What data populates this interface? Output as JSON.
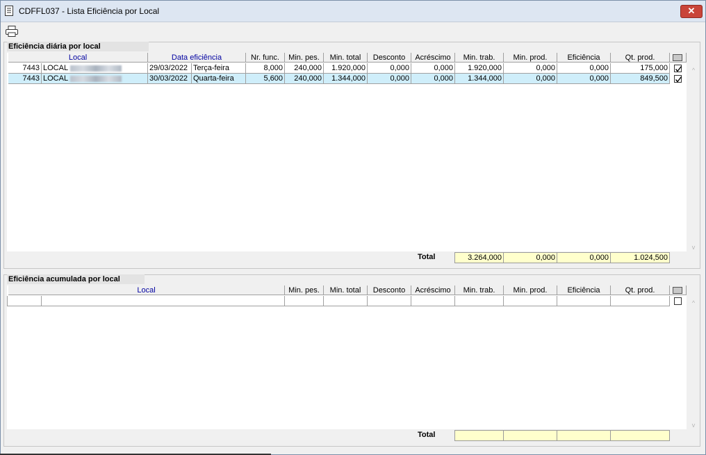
{
  "window": {
    "title": "CDFFL037 - Lista Eficiência por Local",
    "close_symbol": "✕"
  },
  "daily": {
    "title": "Eficiência diária por local",
    "headers": {
      "local": "Local",
      "data": "Data eficiência",
      "nr_func": "Nr. func.",
      "min_pes": "Min. pes.",
      "min_total": "Min. total",
      "desconto": "Desconto",
      "acrescimo": "Acréscimo",
      "min_trab": "Min. trab.",
      "min_prod": "Min. prod.",
      "eficiencia": "Eficiência",
      "qt_prod": "Qt. prod."
    },
    "rows": [
      {
        "code": "7443",
        "local": "LOCAL",
        "date": "29/03/2022",
        "weekday": "Terça-feira",
        "nr_func": "8,000",
        "min_pes": "240,000",
        "min_total": "1.920,000",
        "desconto": "0,000",
        "acrescimo": "0,000",
        "min_trab": "1.920,000",
        "min_prod": "0,000",
        "eficiencia": "0,000",
        "qt_prod": "175,000",
        "checked": true
      },
      {
        "code": "7443",
        "local": "LOCAL",
        "date": "30/03/2022",
        "weekday": "Quarta-feira",
        "nr_func": "5,600",
        "min_pes": "240,000",
        "min_total": "1.344,000",
        "desconto": "0,000",
        "acrescimo": "0,000",
        "min_trab": "1.344,000",
        "min_prod": "0,000",
        "eficiencia": "0,000",
        "qt_prod": "849,500",
        "checked": true
      }
    ],
    "total": {
      "label": "Total",
      "min_trab": "3.264,000",
      "min_prod": "0,000",
      "eficiencia": "0,000",
      "qt_prod": "1.024,500"
    }
  },
  "accumulated": {
    "title": "Eficiência acumulada por local",
    "headers": {
      "local": "Local",
      "min_pes": "Min. pes.",
      "min_total": "Min. total",
      "desconto": "Desconto",
      "acrescimo": "Acréscimo",
      "min_trab": "Min. trab.",
      "min_prod": "Min. prod.",
      "eficiencia": "Eficiência",
      "qt_prod": "Qt. prod."
    },
    "total": {
      "label": "Total"
    }
  },
  "colors": {
    "selected_row": "#cfeefa",
    "total_bg": "#ffffcc",
    "header_blue": "#0000a0"
  },
  "icons": {
    "title": "document-icon",
    "print": "printer-icon"
  }
}
